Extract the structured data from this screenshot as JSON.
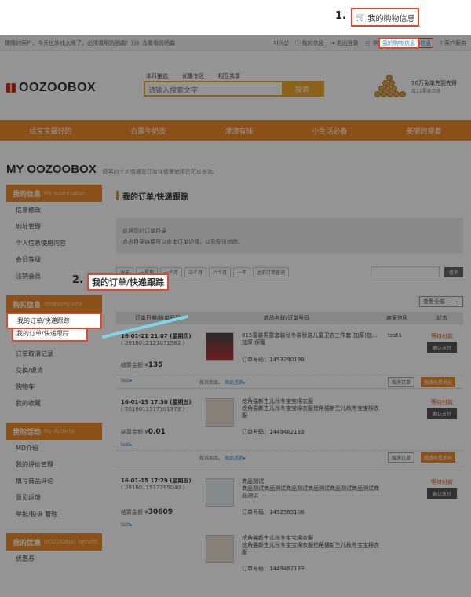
{
  "steps": {
    "step1_number": "1.",
    "step1_label": "我的购物信息",
    "step2_number": "2.",
    "step2_label": "我的订单/快递跟踪"
  },
  "topbar": {
    "welcome": "猜猜的客户，今天也外线太限了，必须请用防晒霜！》》》去看看防晒霜",
    "links": [
      "마이샵",
      "我的信息",
      "退出登录",
      "购物车",
      "我的购物信息",
      "客户服务"
    ]
  },
  "header": {
    "logo": "OOZOOBOX",
    "nav": [
      "本月推选",
      "优惠专区",
      "相互共享"
    ],
    "search_placeholder": "请输入搜索文字",
    "search_button": "搜索",
    "promo_line1": "30万免单先到先得",
    "promo_line2": "双11零食合场"
  },
  "mainnav": [
    "给宝宝最好的",
    "白露牛奶皮",
    "津津有味",
    "小生活必备",
    "美丽的穿着"
  ],
  "page": {
    "title": "MY OOZOOBOX",
    "subtitle": "顾客的个人情报及订单详情等使用已可以查询。"
  },
  "sidebar": [
    {
      "title": "我的信息",
      "en": "My Information",
      "items": [
        "信息修改",
        "地址管理",
        "个人信息使用内容",
        "会员等级",
        "注销会员"
      ]
    },
    {
      "title": "购买信息",
      "en": "Shopping Info",
      "items": [
        "我的订单/快递跟踪",
        "等待付款",
        "订单取消记录",
        "交换/退货",
        "购物车",
        "我的收藏"
      ]
    },
    {
      "title": "我的活动",
      "en": "My Activity",
      "items": [
        "MD介绍",
        "我的评价管理",
        "填写商品评论",
        "意见返馈",
        "举报/投诉 管理"
      ]
    },
    {
      "title": "我的优惠",
      "en": "OOZOOBOX Benefit",
      "items": [
        "优惠券"
      ]
    }
  ],
  "content": {
    "title": "我的订单/快递跟踪",
    "info_line1": "这是您的订单目录",
    "info_line2": "点击目录链接可以查询订单详情，以及配送追踪。",
    "filters": [
      "今天",
      "一星期",
      "一个月",
      "三个月",
      "六个月",
      "一年",
      "之前订单查询"
    ],
    "search_btn": "查询",
    "view_select": "查看全部",
    "columns": [
      "订单日期/帐单号码",
      "商品名称/订单号码",
      "商家信息",
      "状态"
    ],
    "orders": [
      {
        "date": "16-01-21 21:07 (星期四)",
        "num": "( 2016012121071582 )",
        "amount_label": "结算金额 ¥",
        "amount": "135",
        "test": "test▸",
        "products": [
          {
            "name": "015童装男童套装秋冬装秋装儿童卫衣三件套(加厚)加...",
            "name2": "加厚 保暖",
            "order_no": "订单号码：1453290198"
          }
        ],
        "seller": "test1",
        "status": "等待付款",
        "pay": "确认支付",
        "footer": "投诉商品，",
        "footer_link": "商品咨询▸",
        "cancel": "取消订单",
        "modify": "修改收货地址"
      },
      {
        "date": "16-01-15 17:30 (星期五)",
        "num": "( 2016011517301973 )",
        "amount_label": "结算金额 ¥",
        "amount": "0.01",
        "test": "test▸",
        "products": [
          {
            "name": "挖角猫新生儿秋冬宝宝棉衣服",
            "name2": "挖角猫新生儿秋冬宝宝棉衣服挖角猫新生儿秋冬宝宝棉衣服",
            "order_no": "订单号码：1449462133"
          }
        ],
        "seller": "",
        "status": "等待付款",
        "pay": "确认支付",
        "footer": "投诉商品，",
        "footer_link": "商品咨询▸",
        "cancel": "取消订单",
        "modify": "修改收货地址"
      },
      {
        "date": "16-01-15 17:29 (星期五)",
        "num": "( 2016011517295040 )",
        "amount_label": "结算金额 ¥",
        "amount": "30609",
        "test": "test▸",
        "products": [
          {
            "name": "商品测试",
            "name2": "商品测试商品测试商品测试商品测试商品测试商品测试商品测试",
            "order_no": "订单号码：1452565108"
          },
          {
            "name": "挖角猫新生儿秋冬宝宝棉衣服",
            "name2": "挖角猫新生儿秋冬宝宝棉衣服挖角猫新生儿秋冬宝宝棉衣服",
            "order_no": "订单号码：1449462133"
          }
        ],
        "seller": "",
        "status": "等待付款",
        "pay": "确认支付"
      }
    ]
  }
}
